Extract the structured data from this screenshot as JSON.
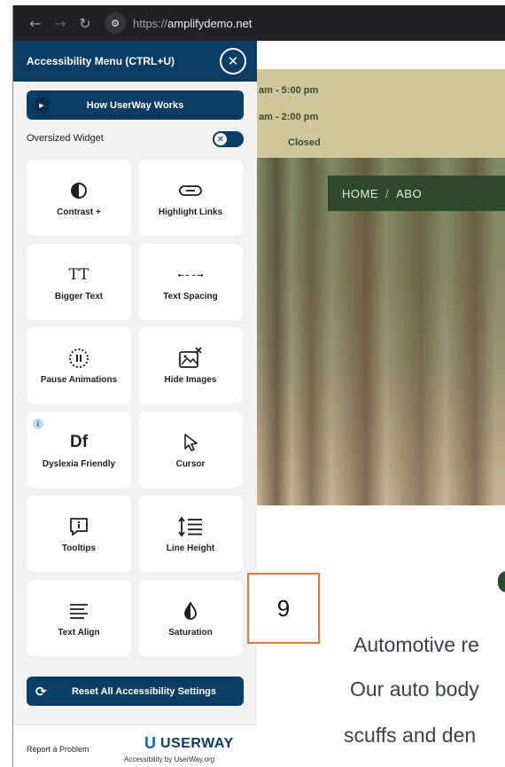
{
  "browser": {
    "back_glyph": "←",
    "forward_glyph": "→",
    "reload_glyph": "↻",
    "site_info_glyph": "⚙",
    "url_scheme": "https://",
    "url_host": "amplifydemo.net"
  },
  "site": {
    "hours": [
      "am - 5:00 pm",
      "am - 2:00 pm",
      "Closed"
    ],
    "nav_home": "HOME",
    "nav_sep": "/",
    "nav_about": "ABO",
    "text_lines": [
      "Automotive re",
      "Our auto body",
      "scuffs and den"
    ]
  },
  "panel": {
    "title": "Accessibility Menu (CTRL+U)",
    "close_glyph": "✕",
    "how_button": "How UserWay Works",
    "oversized_label": "Oversized Widget",
    "toggle_glyph": "✕",
    "tiles": [
      {
        "label": "Contrast +",
        "icon": "contrast-icon"
      },
      {
        "label": "Highlight Links",
        "icon": "link-icon"
      },
      {
        "label": "Bigger Text",
        "icon": "bigger-text-icon"
      },
      {
        "label": "Text Spacing",
        "icon": "text-spacing-icon"
      },
      {
        "label": "Pause Animations",
        "icon": "pause-animations-icon"
      },
      {
        "label": "Hide Images",
        "icon": "hide-images-icon"
      },
      {
        "label": "Dyslexia Friendly",
        "icon": "dyslexia-icon",
        "badge": "i"
      },
      {
        "label": "Cursor",
        "icon": "cursor-icon"
      },
      {
        "label": "Tooltips",
        "icon": "tooltips-icon"
      },
      {
        "label": "Line Height",
        "icon": "line-height-icon"
      },
      {
        "label": "Text Align",
        "icon": "text-align-icon"
      },
      {
        "label": "Saturation",
        "icon": "saturation-icon"
      }
    ],
    "icon_text": {
      "bigger_text": "TT",
      "text_spacing": "←--→",
      "dyslexia": "Df"
    },
    "reset_button": "Reset All Accessibility Settings",
    "report_link": "Report a Problem",
    "brand_u": "U",
    "brand_name": "USERWAY",
    "brand_tagline": "Accessibility by UserWay.org"
  },
  "callout": {
    "value": "9"
  }
}
